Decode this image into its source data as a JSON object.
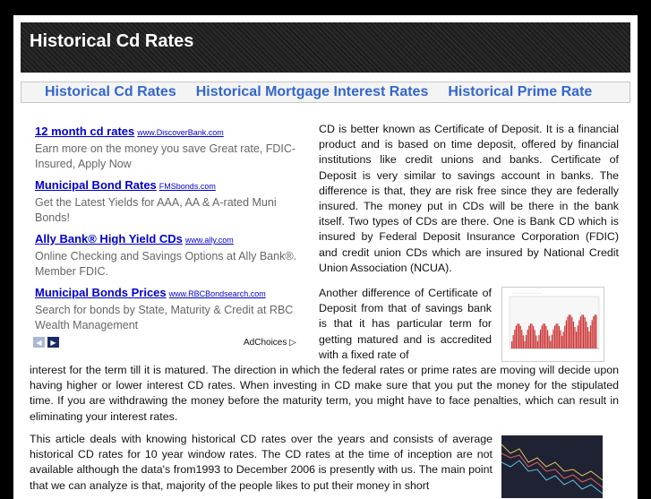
{
  "header": {
    "title": "Historical Cd Rates"
  },
  "nav": {
    "items": [
      "Historical Cd Rates",
      "Historical Mortgage Interest Rates",
      "Historical Prime Rate"
    ]
  },
  "ads": [
    {
      "title": "12 month cd rates",
      "url": "www.DiscoverBank.com",
      "desc": "Earn more on the money you save Great rate, FDIC-Insured, Apply Now"
    },
    {
      "title": "Municipal Bond Rates",
      "url": "FMSbonds.com",
      "desc": "Get the Latest Yields for AAA, AA & A-rated Muni Bonds!"
    },
    {
      "title": "Ally Bank® High Yield CDs",
      "url": "www.ally.com",
      "desc": "Online Checking and Savings Options at Ally Bank®. Member FDIC."
    },
    {
      "title": "Municipal Bonds Prices",
      "url": "www.RBCBondsearch.com",
      "desc": "Search for bonds by State, Maturity & Credit at RBC Wealth Management"
    }
  ],
  "ad_choices": "AdChoices",
  "article": {
    "p1": "CD is better known as Certificate of Deposit. It is a financial product and is based on time deposit, offered by financial institutions like credit unions and banks. Certificate of Deposit is very similar to savings account in banks. The difference is that, they are risk free since they are federally insured. The money put in CDs will be there in the bank itself. Two types of CDs are there. One is Bank CD which is insured by Federal Deposit Insurance Corporation (FDIC) and credit union CDs which are insured by National Credit Union Association (NCUA).",
    "p2a": "Another difference of Certificate of Deposit from that of savings bank is that it has particular term for getting matured and is accredited with a fixed rate of",
    "p2b": "interest for the term till it is matured. The direction in which the federal rates or prime rates are moving will decide upon having higher or lower interest CD rates. When investing in CD make sure that you put the money for the stipulated time. If you are withdrawing the money before the maturity term, you might have to face penalties, which can result in eliminating your interest rates.",
    "p3": "This article deals with knowing historical CD rates over the years and consists of average historical CD rates for 10 year window rates. The CD rates at the time of inception are not available although the data's from1993 to December 2006 is presently with us. The main point that we can analyze is that, majority of the people likes to put their money in short"
  },
  "colors": {
    "link": "#0000cc",
    "nav": "#3366cc",
    "chart_bar": "#cc3333"
  }
}
